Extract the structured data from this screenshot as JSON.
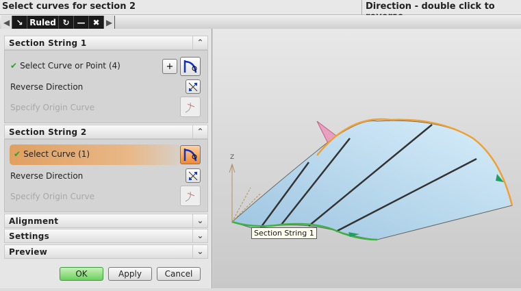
{
  "cue": "Select curves for section 2",
  "status": "Direction - double click to reverse",
  "toolbar": {
    "title": "Ruled"
  },
  "section1": {
    "title": "Section String 1",
    "select": "Select Curve or Point (4)",
    "reverse": "Reverse Direction",
    "origin": "Specify Origin Curve"
  },
  "section2": {
    "title": "Section String 2",
    "select": "Select Curve (1)",
    "reverse": "Reverse Direction",
    "origin": "Specify Origin Curve"
  },
  "groups": {
    "alignment": "Alignment",
    "settings": "Settings",
    "preview": "Preview"
  },
  "buttons": {
    "ok": "OK",
    "apply": "Apply",
    "cancel": "Cancel"
  },
  "viewport": {
    "tooltip": "Section String 1",
    "axis_z": "Z"
  }
}
